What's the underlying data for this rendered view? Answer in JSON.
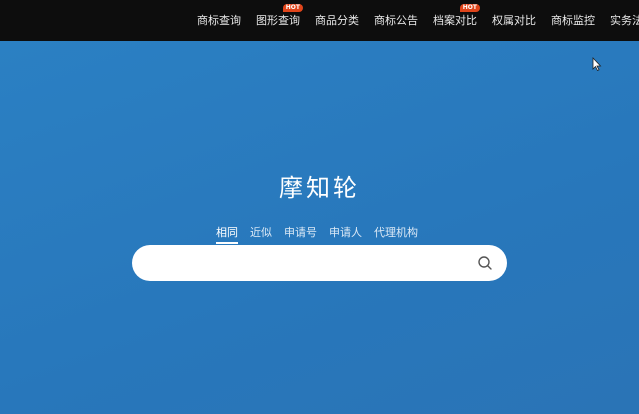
{
  "nav": {
    "items": [
      {
        "label": "商标查询"
      },
      {
        "label": "图形查询",
        "badge": "HOT"
      },
      {
        "label": "商品分类"
      },
      {
        "label": "商标公告"
      },
      {
        "label": "档案对比",
        "badge": "HOT"
      },
      {
        "label": "权属对比"
      },
      {
        "label": "商标监控"
      },
      {
        "label": "实务法律"
      }
    ]
  },
  "hero": {
    "brand": "摩知轮",
    "tabs": [
      {
        "label": "相同",
        "active": true
      },
      {
        "label": "近似"
      },
      {
        "label": "申请号"
      },
      {
        "label": "申请人"
      },
      {
        "label": "代理机构"
      }
    ],
    "search": {
      "placeholder": "",
      "value": "",
      "icon": "search-icon"
    }
  },
  "colors": {
    "topbar": "#0d0d0d",
    "hero": "#2a7dc0",
    "hot_badge": "#e0451b"
  }
}
